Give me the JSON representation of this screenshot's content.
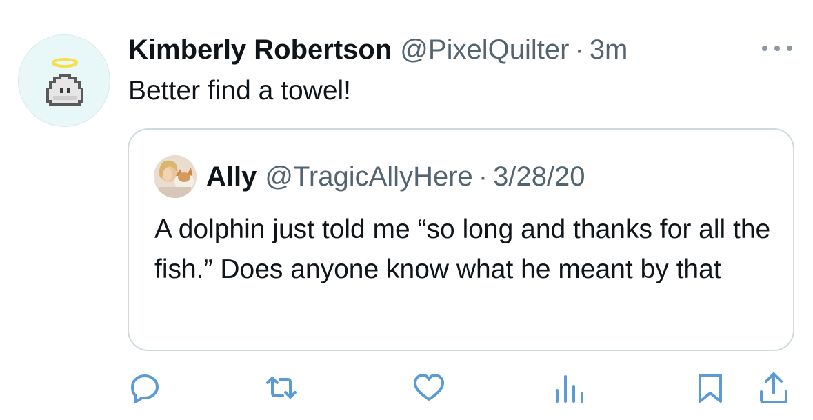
{
  "author": {
    "display_name": "Kimberly Robertson",
    "handle": "@PixelQuilter",
    "separator": "·",
    "time": "3m",
    "avatar_icon": "pixel-ghost-with-halo"
  },
  "tweet_text": "Better find a towel!",
  "quoted": {
    "display_name": "Ally",
    "handle": "@TragicAllyHere",
    "separator": "·",
    "date": "3/28/20",
    "text": "A dolphin just told me “so long and thanks for all the fish.” Does anyone know what he meant by that",
    "avatar_icon": "user-photo-with-dog"
  },
  "actions": [
    {
      "name": "reply",
      "icon": "reply-bubble-icon"
    },
    {
      "name": "retweet",
      "icon": "retweet-icon"
    },
    {
      "name": "like",
      "icon": "heart-icon"
    },
    {
      "name": "views",
      "icon": "analytics-icon"
    },
    {
      "name": "bookmark",
      "icon": "bookmark-icon"
    },
    {
      "name": "share",
      "icon": "share-icon"
    }
  ],
  "colors": {
    "text": "#0f1419",
    "secondary": "#536471",
    "icon": "#5b9bd5",
    "border": "#cfd9de"
  }
}
